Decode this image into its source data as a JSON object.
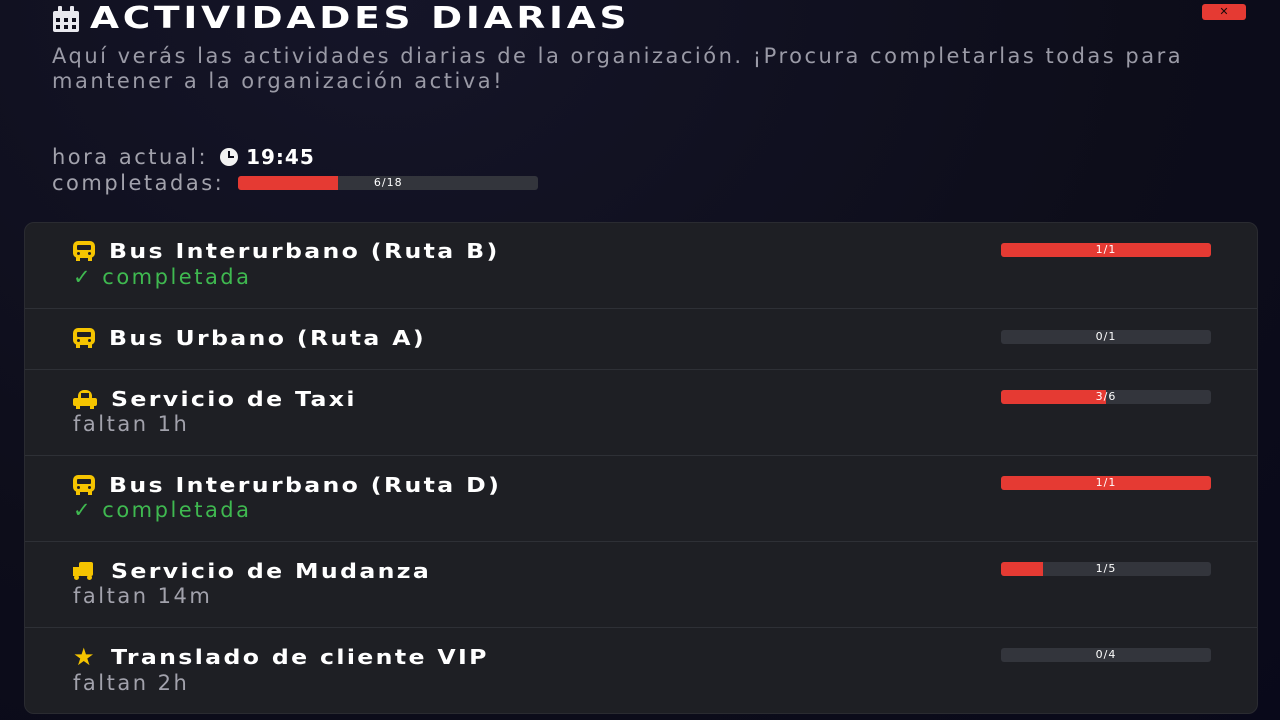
{
  "header": {
    "title": "ACTIVIDADES DIARIAS",
    "close_label": "✕"
  },
  "description": "Aquí verás las actividades diarias de la organización. ¡Procura completarlas todas para mantener a la organización activa!",
  "info": {
    "time_label": "hora actual:",
    "time_value": "19:45",
    "completed_label": "completadas:",
    "completed_text": "6/18",
    "completed_fraction": 0.333
  },
  "colors": {
    "accent": "#e53a33",
    "success": "#3fb950",
    "icon": "#f5c400",
    "track": "#33353c"
  },
  "activities": [
    {
      "icon": "bus-icon",
      "name": "Bus Interurbano (Ruta B)",
      "progress_text": "1/1",
      "progress": 1.0,
      "status": "✓ completada",
      "status_type": "done"
    },
    {
      "icon": "bus-icon",
      "name": "Bus Urbano (Ruta A)",
      "progress_text": "0/1",
      "progress": 0.0,
      "status": "",
      "status_type": "none"
    },
    {
      "icon": "taxi-icon",
      "name": "Servicio de Taxi",
      "progress_text": "3/6",
      "progress": 0.5,
      "status": "faltan 1h",
      "status_type": "pending"
    },
    {
      "icon": "bus-icon",
      "name": "Bus Interurbano (Ruta D)",
      "progress_text": "1/1",
      "progress": 1.0,
      "status": "✓ completada",
      "status_type": "done"
    },
    {
      "icon": "truck-icon",
      "name": "Servicio de Mudanza",
      "progress_text": "1/5",
      "progress": 0.2,
      "status": "faltan 14m",
      "status_type": "pending"
    },
    {
      "icon": "star-icon",
      "name": "Translado de cliente VIP",
      "progress_text": "0/4",
      "progress": 0.0,
      "status": "faltan 2h",
      "status_type": "pending"
    }
  ]
}
